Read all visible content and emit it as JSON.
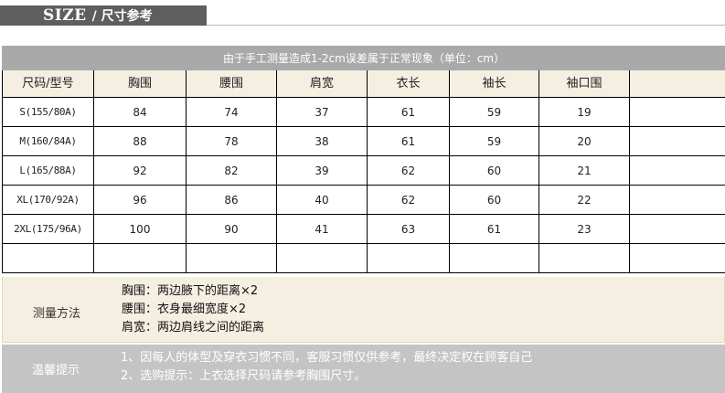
{
  "header": {
    "size_word": "SIZE",
    "title": "/ 尺寸参考"
  },
  "notice": "由于手工测量造成1-2cm误差属于正常现象（单位：cm）",
  "table": {
    "columns": [
      "尺码/型号",
      "胸围",
      "腰围",
      "肩宽",
      "衣长",
      "袖长",
      "袖口围",
      ""
    ],
    "rows": [
      [
        "S(155/80A)",
        "84",
        "74",
        "37",
        "61",
        "59",
        "19",
        ""
      ],
      [
        "M(160/84A)",
        "88",
        "78",
        "38",
        "61",
        "59",
        "20",
        ""
      ],
      [
        "L(165/88A)",
        "92",
        "82",
        "39",
        "62",
        "60",
        "21",
        ""
      ],
      [
        "XL(170/92A)",
        "96",
        "86",
        "40",
        "62",
        "60",
        "22",
        ""
      ],
      [
        "2XL(175/96A)",
        "100",
        "90",
        "41",
        "63",
        "61",
        "23",
        ""
      ],
      [
        "",
        "",
        "",
        "",
        "",
        "",
        "",
        ""
      ]
    ]
  },
  "measure": {
    "label": "测量方法",
    "lines": [
      "胸围：两边腋下的距离×2",
      "腰围：衣身最细宽度×2",
      "肩宽：两边肩线之间的距离"
    ]
  },
  "tips": {
    "label": "温馨提示",
    "lines": [
      "1、因每人的体型及穿衣习惯不同，客服习惯仅供参考，最终决定权在顾客自己",
      "2、选购提示：上衣选择尺码请参考胸围尺寸。"
    ]
  }
}
